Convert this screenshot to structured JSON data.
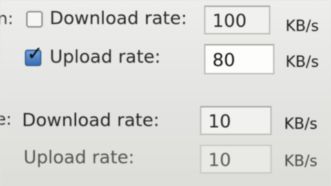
{
  "section1": {
    "prefix_fragment": "n:",
    "download": {
      "checked": false,
      "label": "Download rate:",
      "value": "100",
      "unit": "KB/s"
    },
    "upload": {
      "checked": true,
      "check_glyph": "✓",
      "label": "Upload rate:",
      "value": "80",
      "unit": "KB/s"
    }
  },
  "section2": {
    "prefix_fragment": "e:",
    "download": {
      "label": "Download rate:",
      "value": "10",
      "unit": "KB/s"
    },
    "upload": {
      "label": "Upload rate:",
      "value": "10",
      "unit": "KB/s"
    }
  }
}
